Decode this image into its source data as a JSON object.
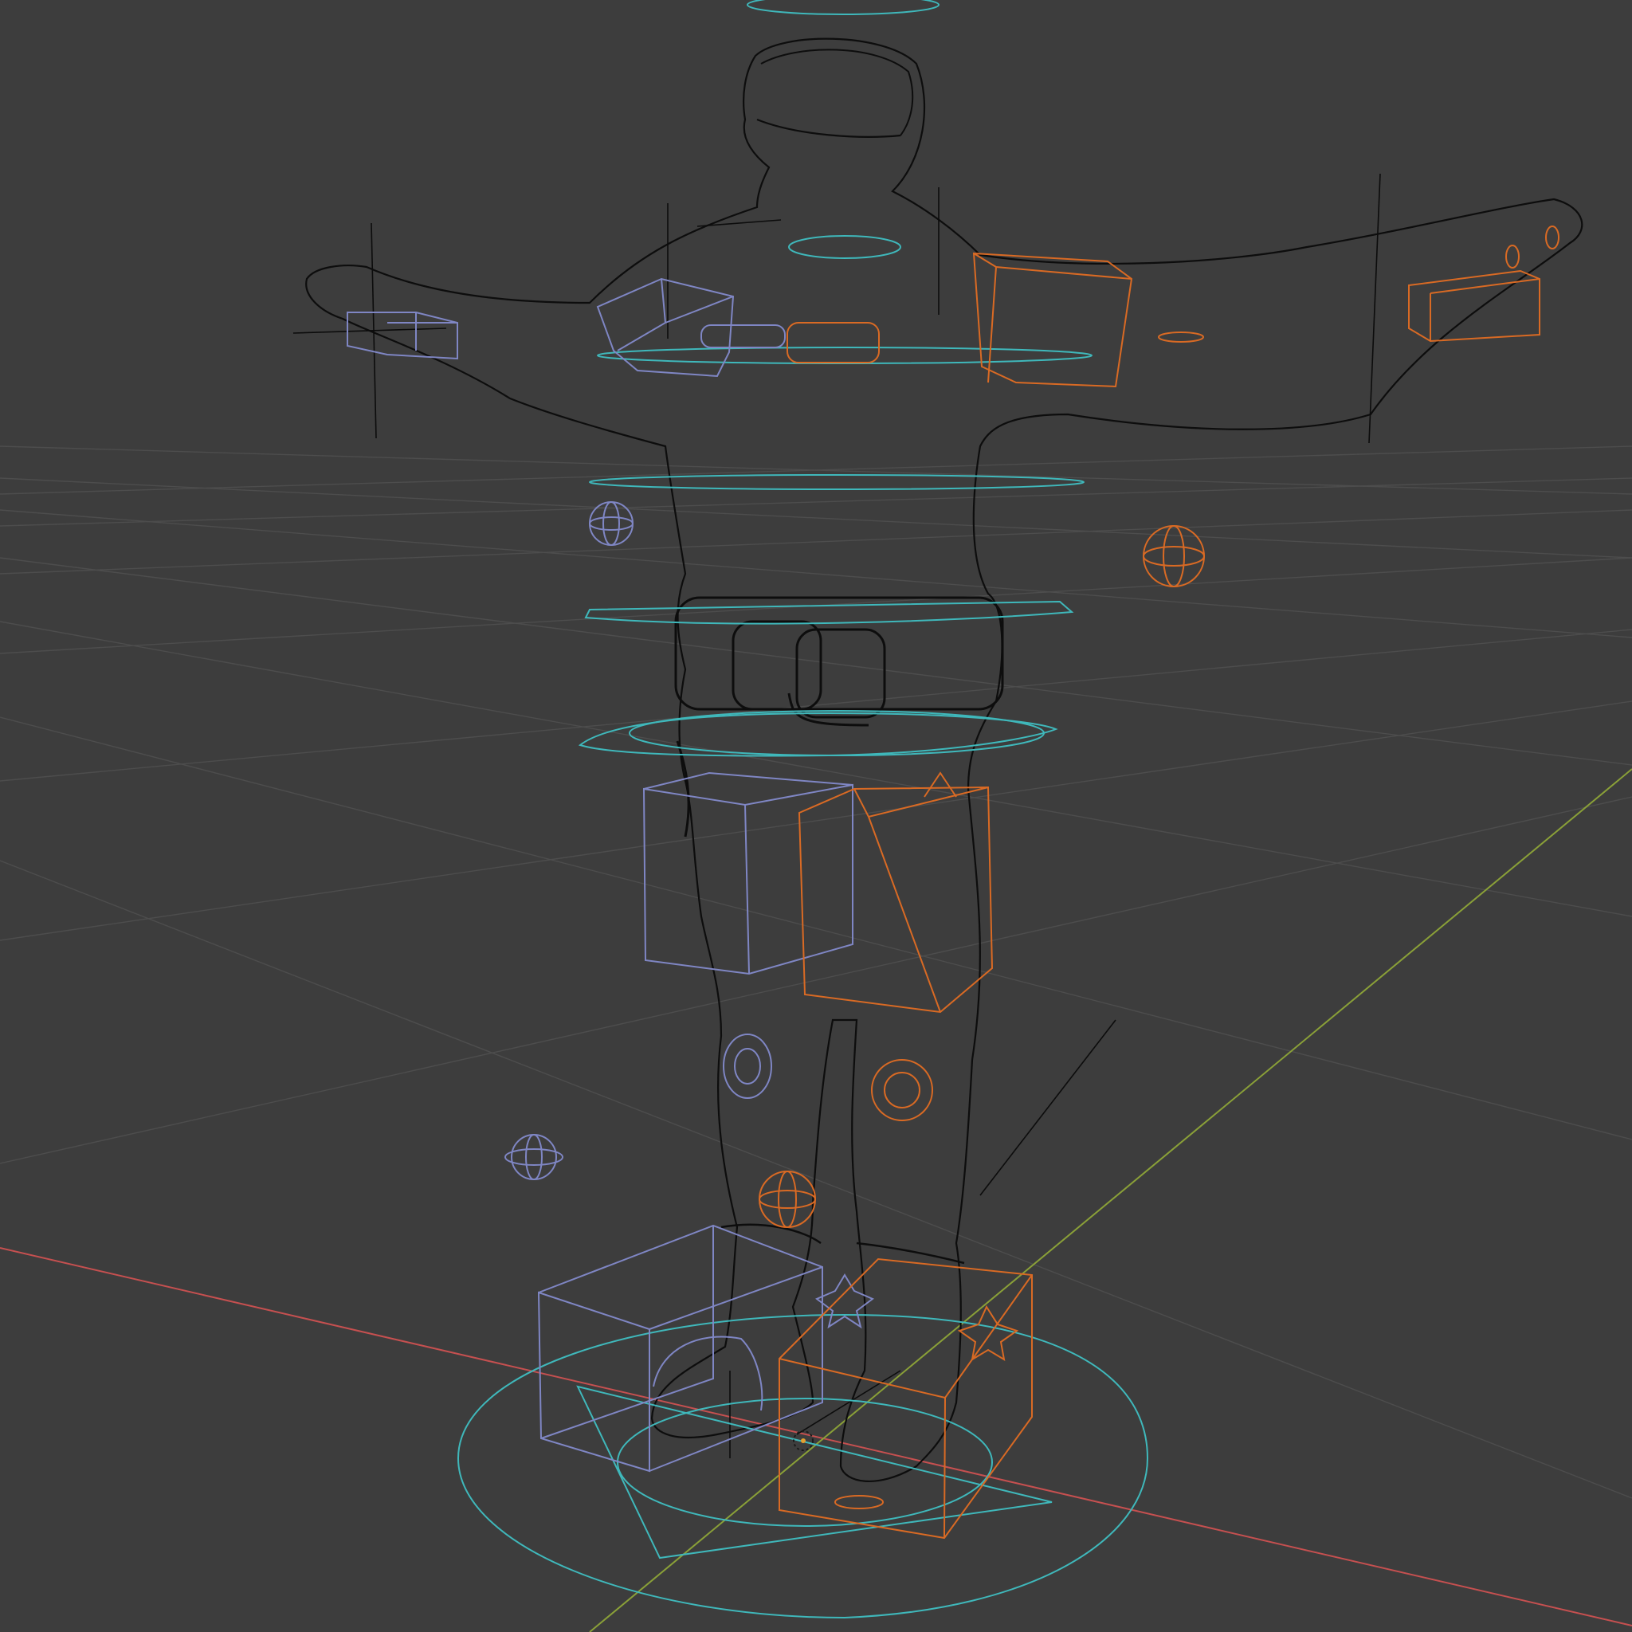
{
  "viewport": {
    "editor": "3D Viewport",
    "shading": "wireframe",
    "view": "perspective",
    "background_color": "#3d3d3d",
    "grid_color": "#4d4d4d",
    "colors": {
      "x_axis": "#c65050",
      "y_axis": "#8aa038",
      "mesh_wire": "#101010",
      "controls_left": "#7f86c4",
      "controls_right": "#d96a24",
      "controls_center": "#3fb8bb",
      "bone_lines": "#0c0c0c"
    },
    "scene": {
      "object": "character-rig",
      "pose": "t-pose",
      "controls_left_side": [
        "hand-box",
        "upper-arm-box",
        "shoulder-circle",
        "elbow-gimbal",
        "thigh-box",
        "knee-ring",
        "knee-gimbal",
        "foot-box",
        "heel-circle"
      ],
      "controls_right_side": [
        "hand-box",
        "upper-arm-box",
        "shoulder-circle",
        "elbow-gimbal",
        "thigh-box",
        "knee-ring",
        "knee-gimbal",
        "foot-box",
        "heel-circle"
      ],
      "controls_center": [
        "head-ring",
        "neck-ring",
        "chest-ring",
        "spine-ring",
        "waist-ring",
        "hips-ring",
        "root-circle",
        "root-triangle"
      ]
    }
  }
}
